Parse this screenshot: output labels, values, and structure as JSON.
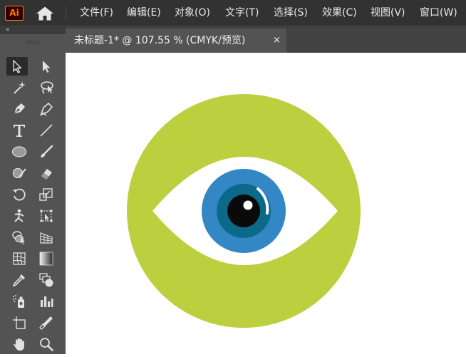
{
  "app": {
    "logo_text": "Ai"
  },
  "menu": [
    {
      "label": "文件(F)"
    },
    {
      "label": "编辑(E)"
    },
    {
      "label": "对象(O)"
    },
    {
      "label": "文字(T)"
    },
    {
      "label": "选择(S)"
    },
    {
      "label": "效果(C)"
    },
    {
      "label": "视图(V)"
    },
    {
      "label": "窗口(W)"
    }
  ],
  "toolbar": {
    "collapse_glyph": "«",
    "tools": [
      "selection-tool-icon",
      "direct-selection-tool-icon",
      "magic-wand-tool-icon",
      "lasso-tool-icon",
      "pen-tool-icon",
      "curvature-tool-icon",
      "type-tool-icon",
      "line-segment-tool-icon",
      "ellipse-tool-icon",
      "paintbrush-tool-icon",
      "shaper-tool-icon",
      "eraser-tool-icon",
      "rotate-tool-icon",
      "scale-tool-icon",
      "puppet-warp-tool-icon",
      "free-transform-tool-icon",
      "shape-builder-tool-icon",
      "perspective-grid-tool-icon",
      "mesh-tool-icon",
      "gradient-tool-icon",
      "eyedropper-tool-icon",
      "blend-tool-icon",
      "symbol-sprayer-tool-icon",
      "column-graph-tool-icon",
      "artboard-tool-icon",
      "slice-tool-icon",
      "hand-tool-icon",
      "zoom-tool-icon"
    ]
  },
  "document": {
    "tab_title": "未标题-1* @ 107.55 % (CMYK/预览)",
    "close_glyph": "×"
  },
  "artwork": {
    "colors": {
      "outer_circle": "#bccf3f",
      "eye_white": "#ffffff",
      "iris_outer": "#3387c4",
      "iris_inner": "#0b6a8a",
      "pupil": "#0a0a0a",
      "highlight": "#ffffff"
    }
  }
}
